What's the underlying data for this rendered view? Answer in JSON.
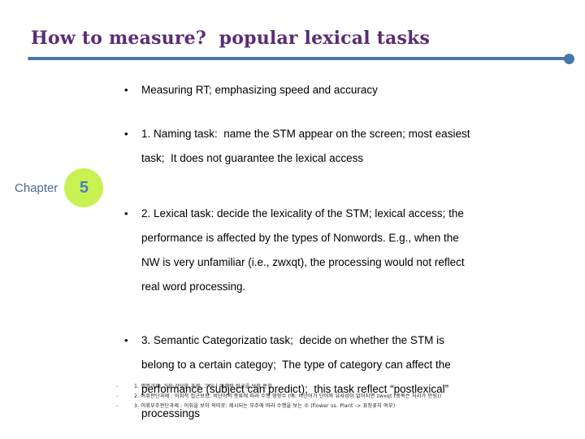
{
  "slide": {
    "title": "How to measure?  popular lexical tasks",
    "accent_color": "#4878a8",
    "title_color": "#5a2d73",
    "badge_color": "#c7f252",
    "badge_number_color": "#4a7fc1"
  },
  "chapter": {
    "label": "Chapter",
    "number": "5"
  },
  "bullets": [
    {
      "marker": "•",
      "lines": [
        "Measuring RT; emphasizing speed and accuracy"
      ]
    },
    {
      "marker": "•",
      "lines": [
        "1. Naming task:  name the STM appear on the screen; most easiest",
        "task;  It does not guarantee the lexical access"
      ]
    },
    {
      "marker": "•",
      "lines": [
        "2. Lexical task: decide the lexicality of the STM; lexical access; the",
        "performance is affected by the types of Nonwords. E.g., when the",
        "NW is very unfamiliar (i.e., zwxqt), the processing would not reflect",
        "real word processing."
      ]
    },
    {
      "marker": "•",
      "lines": [
        "3. Semantic Categorizatio task;  decide on whether the STM is",
        "belong to a certain categoy;  The type of category can affect the",
        "performance (subject can predict);  this task reflect “postlexical”",
        "processings"
      ]
    }
  ],
  "footnotes": [
    {
      "marker": "-",
      "text": "1. 명명과제: 가장 간단한 과제; 그러나 어휘적 접근을 보장 못함"
    },
    {
      "marker": "-",
      "text": "2. 어휘판단과제 : 어휘적 접근보장; 비단어의 종류에 따라 수행 영향수 (예: 비단어가 단어와 유사성이 없어지면 zwxqt (중복은 처리가 안됨))"
    },
    {
      "marker": "-",
      "text": "3. 어휘부주판단과제 : 어휘을 보이 의미로: 제시되는 부주에 따라 수행을 보는 수 (flower vs. Plant -> 표정꽃지 여부)"
    }
  ]
}
